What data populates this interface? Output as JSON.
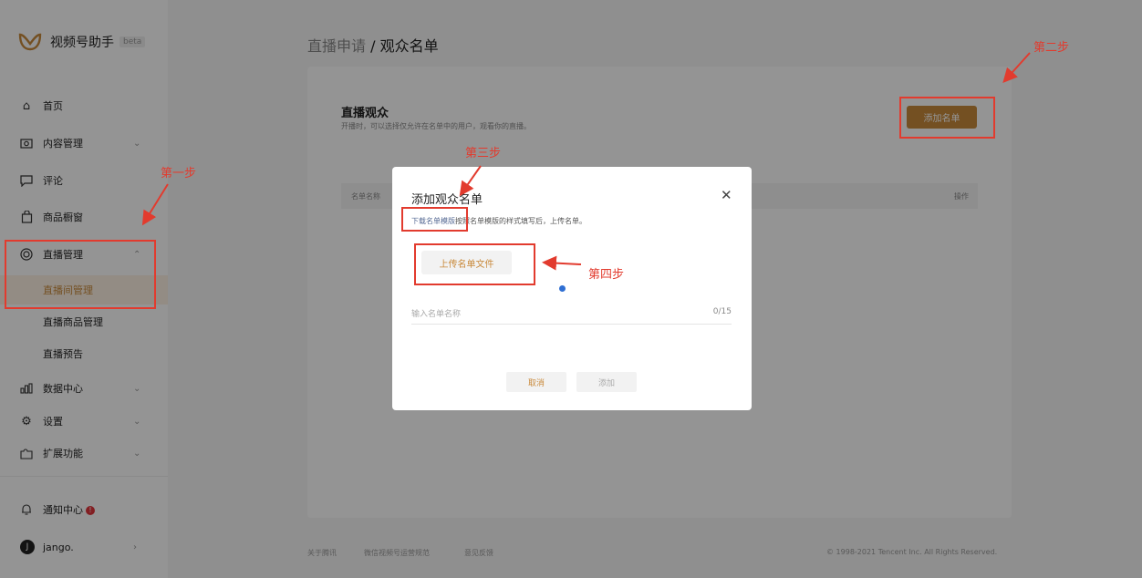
{
  "app": {
    "name": "视频号助手",
    "badge": "beta"
  },
  "sidebar": {
    "items": [
      {
        "label": "首页",
        "icon": "home-icon"
      },
      {
        "label": "内容管理",
        "icon": "camera-icon"
      },
      {
        "label": "评论",
        "icon": "comment-icon"
      },
      {
        "label": "商品橱窗",
        "icon": "shopping-bag-icon"
      },
      {
        "label": "直播管理",
        "icon": "live-icon"
      },
      {
        "label": "数据中心",
        "icon": "chart-icon"
      },
      {
        "label": "设置",
        "icon": "gear-icon"
      },
      {
        "label": "扩展功能",
        "icon": "extension-icon"
      }
    ],
    "sub_items": [
      "直播间管理",
      "直播商品管理",
      "直播预告"
    ],
    "notification": "通知中心",
    "notification_badge": "!",
    "user": "jango.",
    "user_initial": "J"
  },
  "breadcrumb": {
    "prev": "直播申请",
    "sep": " / ",
    "current": "观众名单"
  },
  "card": {
    "title": "直播观众",
    "desc": "开播时，可以选择仅允许在名单中的用户，观看你的直播。",
    "add_button": "添加名单",
    "table_headers": [
      "名单名称",
      "操作"
    ]
  },
  "modal": {
    "title": "添加观众名单",
    "download_link": "下载名单模版",
    "desc_rest": "按照名单模版的样式填写后，上传名单。",
    "upload_button": "上传名单文件",
    "name_placeholder": "输入名单名称",
    "name_count": "0/15",
    "cancel": "取消",
    "add": "添加"
  },
  "footer": {
    "links": [
      "关于腾讯",
      "微信视频号运营规范",
      "意见反馈"
    ],
    "copyright": "© 1998-2021 Tencent Inc. All Rights Reserved."
  },
  "annotations": [
    "第一步",
    "第二步",
    "第三步",
    "第四步"
  ],
  "colors": {
    "accent": "#c98a3c",
    "annotation": "#e23b2e",
    "link": "#576b95"
  }
}
